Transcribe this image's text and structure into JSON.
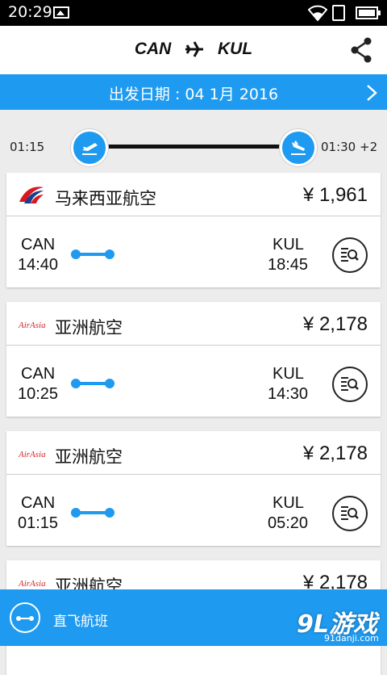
{
  "status_bar": {
    "time": "20:29",
    "battery_level": 1.0
  },
  "header": {
    "origin": "CAN",
    "destination": "KUL"
  },
  "date_bar": {
    "label": "出发日期 : 04 1月 2016"
  },
  "time_filter": {
    "start": "01:15",
    "end": "01:30 +2"
  },
  "flights": [
    {
      "airline": "马来西亚航空",
      "logo": "malaysia-airlines-logo",
      "price": "¥ 1,961",
      "dep_code": "CAN",
      "dep_time": "14:40",
      "arr_code": "KUL",
      "arr_time": "18:45"
    },
    {
      "airline": "亚洲航空",
      "logo": "airasia-logo",
      "logo_text": "AirAsia",
      "price": "¥ 2,178",
      "dep_code": "CAN",
      "dep_time": "10:25",
      "arr_code": "KUL",
      "arr_time": "14:30"
    },
    {
      "airline": "亚洲航空",
      "logo": "airasia-logo",
      "logo_text": "AirAsia",
      "price": "¥ 2,178",
      "dep_code": "CAN",
      "dep_time": "01:15",
      "arr_code": "KUL",
      "arr_time": "05:20"
    },
    {
      "airline": "亚洲航空",
      "logo": "airasia-logo",
      "logo_text": "AirAsia",
      "price": "¥ 2,178"
    }
  ],
  "bottom_bar": {
    "label": "直飞航班"
  },
  "watermark": {
    "text": "9L游戏",
    "sub": "91danji.com"
  },
  "colors": {
    "accent": "#1e9af0",
    "airasia_red": "#d8232a",
    "mas_red": "#d71920",
    "mas_blue": "#1b3f8f"
  }
}
